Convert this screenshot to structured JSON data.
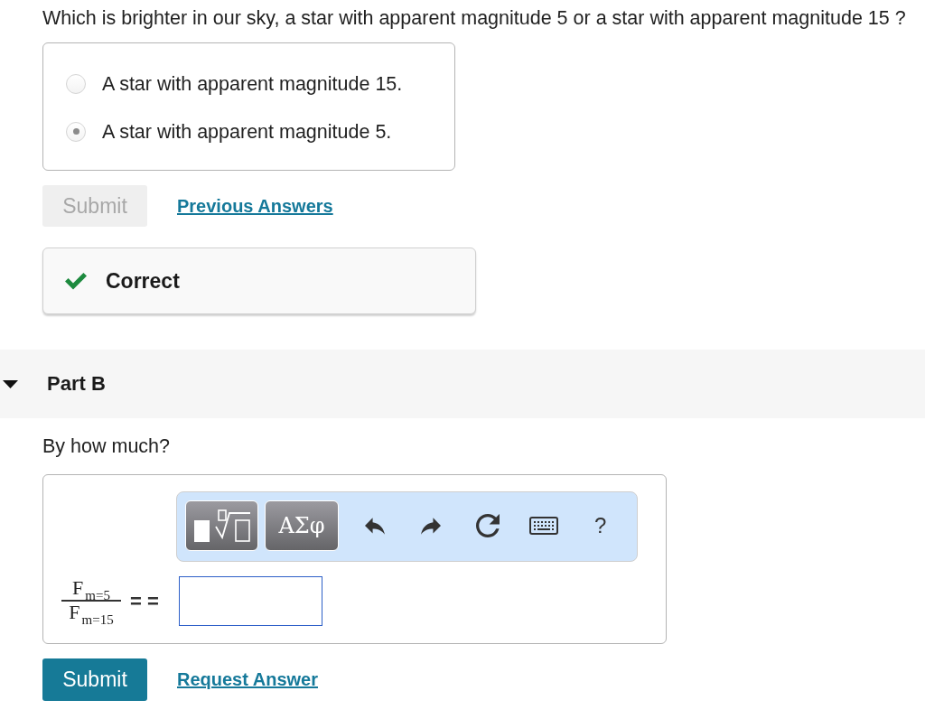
{
  "question": "Which is brighter in our sky, a star with apparent magnitude 5 or a star with apparent magnitude 15 ?",
  "part_a": {
    "options": [
      {
        "label": "A star with apparent magnitude 15.",
        "selected": false
      },
      {
        "label": "A star with apparent magnitude 5.",
        "selected": true
      }
    ],
    "submit": {
      "label": "Submit",
      "disabled": true
    },
    "link": "Previous Answers",
    "feedback": {
      "kind": "correct",
      "label": "Correct"
    }
  },
  "part_b": {
    "title": "Part B",
    "expanded": true,
    "prompt": "By how much?",
    "toolbar": [
      {
        "kind": "templates"
      },
      {
        "kind": "symbols",
        "label": "ΑΣφ"
      },
      {
        "kind": "undo"
      },
      {
        "kind": "redo"
      },
      {
        "kind": "reset"
      },
      {
        "kind": "keyboard"
      },
      {
        "kind": "help",
        "label": "?"
      }
    ],
    "equation": {
      "numerator": "F$_{m=5}$",
      "denominator": "F$_{m=15}$",
      "relation": "= =",
      "input": {
        "focused": true
      }
    },
    "submit": {
      "label": "Submit",
      "disabled": false
    },
    "link": "Request Answer"
  }
}
